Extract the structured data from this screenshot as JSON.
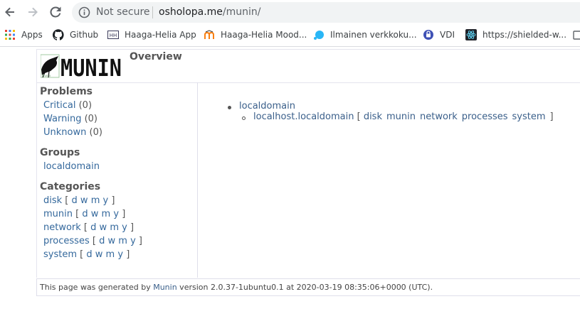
{
  "browser": {
    "security_label": "Not secure",
    "url_host": "osholopa.me",
    "url_path": "/munin/"
  },
  "bookmarks": [
    {
      "label": "Apps",
      "icon": "apps-grid-icon"
    },
    {
      "label": "Github",
      "icon": "github-icon"
    },
    {
      "label": "Haaga-Helia App",
      "icon": "haaga-helia-icon"
    },
    {
      "label": "Haaga-Helia Mood...",
      "icon": "moodle-icon"
    },
    {
      "label": "Ilmainen verkkoku...",
      "icon": "bubble-icon"
    },
    {
      "label": "VDI",
      "icon": "vdi-icon"
    },
    {
      "label": "https://shielded-w...",
      "icon": "react-icon"
    }
  ],
  "page": {
    "title": "Overview"
  },
  "sidebar": {
    "problems_heading": "Problems",
    "problems": [
      {
        "label": "Critical",
        "count": "(0)"
      },
      {
        "label": "Warning",
        "count": "(0)"
      },
      {
        "label": "Unknown",
        "count": "(0)"
      }
    ],
    "groups_heading": "Groups",
    "groups": [
      "localdomain"
    ],
    "categories_heading": "Categories",
    "categories": [
      "disk",
      "munin",
      "network",
      "processes",
      "system"
    ],
    "periods": [
      "d",
      "w",
      "m",
      "y"
    ]
  },
  "content": {
    "group": "localdomain",
    "host": "localhost.localdomain",
    "host_categories": [
      "disk",
      "munin",
      "network",
      "processes",
      "system"
    ]
  },
  "footer": {
    "prefix": "This page was generated by ",
    "link": "Munin",
    "suffix": " version 2.0.37-1ubuntu0.1 at 2020-03-19 08:35:06+0000 (UTC)."
  }
}
